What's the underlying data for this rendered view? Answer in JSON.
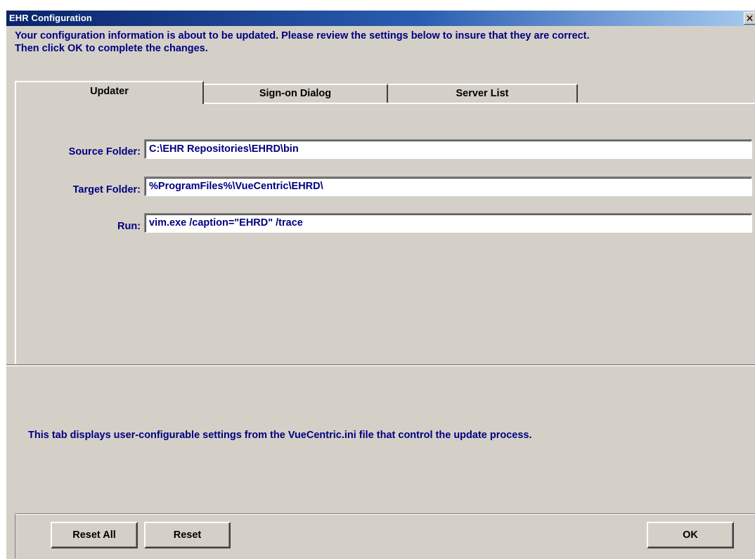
{
  "window": {
    "title": "EHR Configuration",
    "close_glyph": "✕"
  },
  "intro": {
    "line1": "Your configuration information is about to be updated.  Please review the settings below to insure that they are correct.",
    "line2": "Then click OK to complete the changes."
  },
  "tabs": [
    {
      "label": "Updater",
      "selected": true
    },
    {
      "label": "Sign-on Dialog",
      "selected": false
    },
    {
      "label": "Server List",
      "selected": false
    }
  ],
  "fields": {
    "source_folder": {
      "label": "Source Folder:",
      "value": "C:\\EHR Repositories\\EHRD\\bin"
    },
    "target_folder": {
      "label": "Target Folder:",
      "value": "%ProgramFiles%\\VueCentric\\EHRD\\"
    },
    "run": {
      "label": "Run:",
      "value": "vim.exe /caption=\"EHRD\" /trace"
    }
  },
  "description": "This tab displays user-configurable settings from the VueCentric.ini file that control the update process.",
  "buttons": {
    "reset_all": "Reset All",
    "reset": "Reset",
    "ok": "OK"
  },
  "colors": {
    "title_bar": "#0a246a",
    "label_text": "#000080",
    "face": "#d4d0c8"
  }
}
